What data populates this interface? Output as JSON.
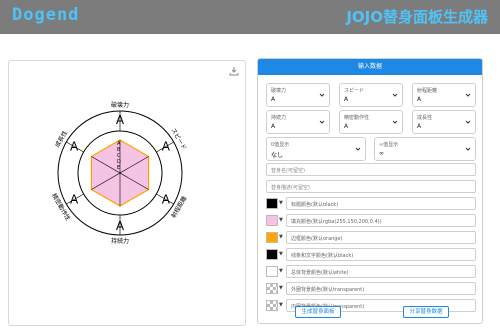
{
  "header": {
    "logo": "Dogend",
    "title": "JOJO替身面板生成器"
  },
  "panel_title": "输入数据",
  "chart": {
    "labels": [
      "破壊力",
      "スピード",
      "射程距離",
      "持続力",
      "精密動作性",
      "成長性"
    ],
    "grades": [
      "A",
      "A",
      "A",
      "A",
      "A",
      "A"
    ],
    "scale_letters": [
      "A",
      "B",
      "C",
      "D",
      "E"
    ],
    "values": [
      1.0,
      1.0,
      1.0,
      1.0,
      1.0,
      1.0
    ],
    "colors": {
      "fill": "#f5c4e4",
      "border": "#ffa500",
      "line": "#000000",
      "outer_bg": "#ffffff"
    }
  },
  "selects": [
    {
      "label": "破壊力",
      "value": "A"
    },
    {
      "label": "スピード",
      "value": "A"
    },
    {
      "label": "射程距離",
      "value": "A"
    },
    {
      "label": "持続力",
      "value": "A"
    },
    {
      "label": "精密動作性",
      "value": "A"
    },
    {
      "label": "成長性",
      "value": "A"
    },
    {
      "label": "0值显示",
      "value": "なし"
    },
    {
      "label": "∞值显示",
      "value": "∞"
    }
  ],
  "inputs": {
    "name_placeholder": "替身名(可留空)",
    "desc_placeholder": "替身描述(可留空)"
  },
  "color_fields": [
    {
      "placeholder": "标题颜色(默认black)",
      "swatch": "#000000"
    },
    {
      "placeholder": "填充颜色(默认rgba(255,150,200,0.4))",
      "swatch": "#f5c4e4"
    },
    {
      "placeholder": "边框颜色(默认orange)",
      "swatch": "#ffa500"
    },
    {
      "placeholder": "线条和文字颜色(默认black)",
      "swatch": "#000000"
    },
    {
      "placeholder": "总体背景颜色(默认white)",
      "swatch": "#ffffff"
    },
    {
      "placeholder": "外圈背景颜色(默认transparent)",
      "swatch": "transparent"
    },
    {
      "placeholder": "内圈背景颜色(默认transparent)",
      "swatch": "transparent"
    }
  ],
  "buttons": {
    "generate": "生成替身面板",
    "share": "分享替身数据"
  }
}
